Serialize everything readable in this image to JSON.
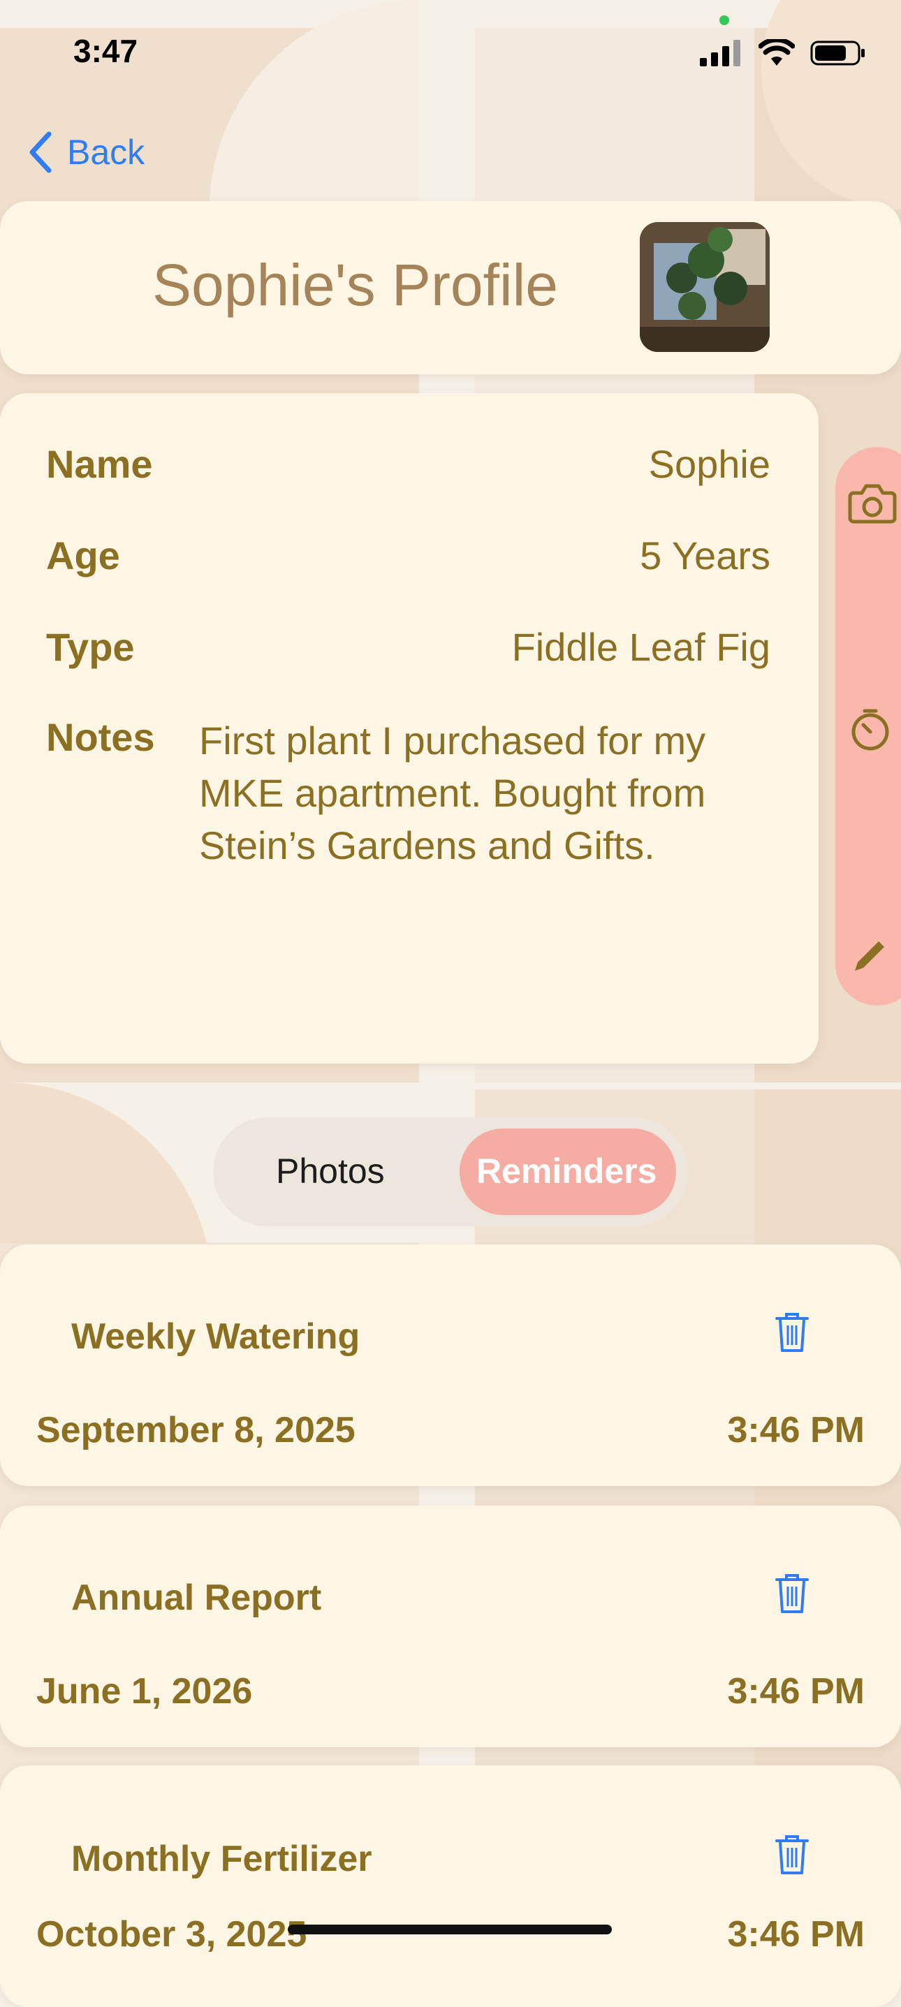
{
  "status_bar": {
    "time": "3:47"
  },
  "nav": {
    "back_label": "Back"
  },
  "profile": {
    "title": "Sophie's Profile",
    "fields": {
      "name_label": "Name",
      "name_value": "Sophie",
      "age_label": "Age",
      "age_value": "5 Years",
      "type_label": "Type",
      "type_value": "Fiddle Leaf Fig",
      "notes_label": "Notes",
      "notes_value": "First plant I purchased for my MKE apartment. Bought from Stein’s Gardens and Gifts."
    }
  },
  "side_actions": [
    "camera-icon",
    "timer-icon",
    "pencil-icon"
  ],
  "segmented": {
    "photos": "Photos",
    "reminders": "Reminders",
    "selected": "Reminders"
  },
  "reminders": [
    {
      "title": "Weekly Watering",
      "date": "September 8, 2025",
      "time": "3:46 PM"
    },
    {
      "title": "Annual Report",
      "date": "June 1, 2026",
      "time": "3:46 PM"
    },
    {
      "title": "Monthly Fertilizer",
      "date": "October 3, 2025",
      "time": "3:46 PM"
    }
  ],
  "colors": {
    "background": "#f6f1e7",
    "card": "#fdf6e4",
    "text_brown": "#8b6f23",
    "title_brown": "#a5845a",
    "accent_pink": "#f9b8ab",
    "link_blue": "#2f7cf6"
  }
}
